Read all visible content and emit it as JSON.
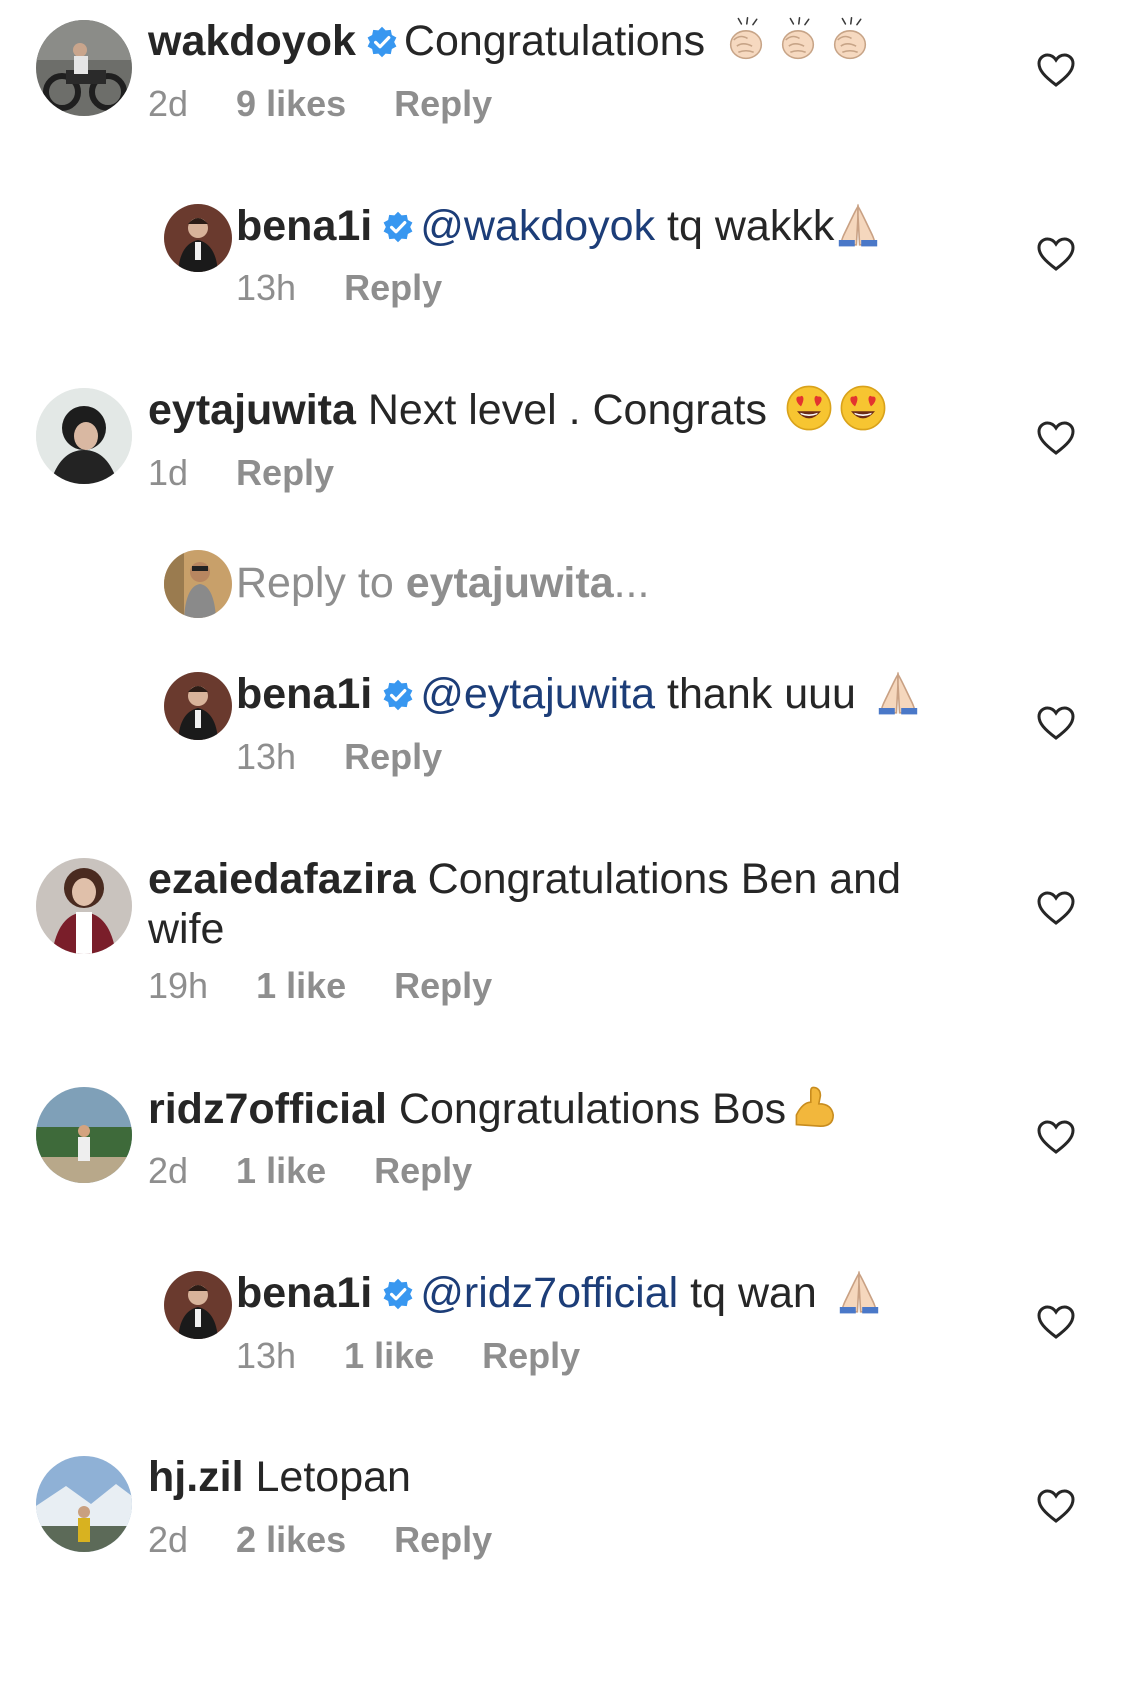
{
  "comments": [
    {
      "username": "wakdoyok",
      "text": "Congratulations",
      "time": "2d",
      "likes": "9 likes",
      "reply_label": "Reply"
    },
    {
      "username": "bena1i",
      "mention": "@wakdoyok",
      "text": " tq wakkk",
      "time": "13h",
      "reply_label": "Reply"
    },
    {
      "username": "eytajuwita",
      "text": "Next level . Congrats",
      "time": "1d",
      "reply_label": "Reply"
    },
    {
      "username": "bena1i",
      "mention": "@eytajuwita",
      "text": " thank uuu",
      "time": "13h",
      "reply_label": "Reply"
    },
    {
      "username": "ezaiedafazira",
      "text": "Congratulations Ben and wife",
      "time": "19h",
      "likes": "1 like",
      "reply_label": "Reply"
    },
    {
      "username": "ridz7official",
      "text": "Congratulations Bos",
      "time": "2d",
      "likes": "1 like",
      "reply_label": "Reply"
    },
    {
      "username": "bena1i",
      "mention": "@ridz7official",
      "text": " tq wan",
      "time": "13h",
      "likes": "1 like",
      "reply_label": "Reply"
    },
    {
      "username": "hj.zil",
      "text": "Letopan",
      "time": "2d",
      "likes": "2 likes",
      "reply_label": "Reply"
    }
  ],
  "reply_prompt": {
    "prefix": "Reply to ",
    "username": "eytajuwita",
    "suffix": "..."
  },
  "colors": {
    "text": "#262626",
    "meta": "#8e8e8e",
    "mention": "#1c3d78",
    "verified": "#3897f0"
  },
  "icons": [
    "verified-badge-icon",
    "heart-outline-icon",
    "clap-emoji",
    "pray-emoji",
    "heart-eyes-emoji",
    "flexed-biceps-emoji"
  ]
}
